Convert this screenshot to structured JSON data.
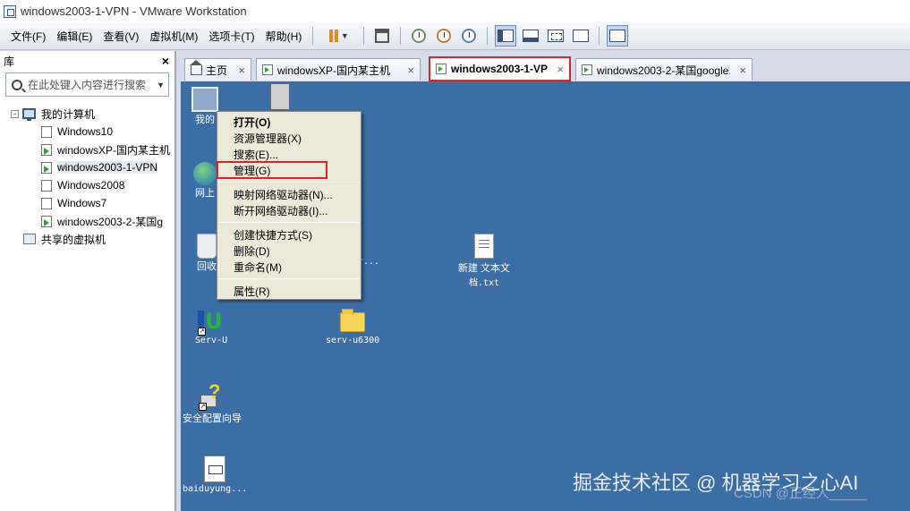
{
  "window": {
    "title": "windows2003-1-VPN - VMware Workstation"
  },
  "menubar": {
    "items": [
      "文件(F)",
      "编辑(E)",
      "查看(V)",
      "虚拟机(M)",
      "选项卡(T)",
      "帮助(H)"
    ]
  },
  "library": {
    "title": "库",
    "close": "×",
    "search_placeholder": "在此处键入内容进行搜索",
    "root": "我的计算机",
    "vms": [
      "Windows10",
      "windowsXP-国内某主机",
      "windows2003-1-VPN",
      "Windows2008",
      "Windows7",
      "windows2003-2-某国g"
    ],
    "shared": "共享的虚拟机"
  },
  "tabs": [
    {
      "label": "主页"
    },
    {
      "label": "windowsXP-国内某主机"
    },
    {
      "label": "windows2003-1-VPN"
    },
    {
      "label": "windows2003-2-某国google..."
    }
  ],
  "tab_close": "×",
  "desktop": {
    "icons": {
      "my_computer": "我的",
      "network": "网上",
      "recycle": "回收",
      "partial": "r...",
      "new_txt_line1": "新建 文本文",
      "new_txt_line2": "档.txt",
      "servu": "Serv-U",
      "servu_folder": "serv-u6300",
      "wizard": "安全配置向导",
      "baidu": "baiduyung..."
    }
  },
  "context_menu": {
    "items": {
      "open": "打开(O)",
      "explorer": "资源管理器(X)",
      "search": "搜索(E)...",
      "manage": "管理(G)",
      "map_drive": "映射网络驱动器(N)...",
      "disconnect_drive": "断开网络驱动器(I)...",
      "create_shortcut": "创建快捷方式(S)",
      "delete": "删除(D)",
      "rename": "重命名(M)",
      "properties": "属性(R)"
    }
  },
  "watermark": {
    "main": "掘金技术社区 @ 机器学习之心AI",
    "faint": "CSDN @正经人_____"
  },
  "colors": {
    "desktop_bg": "#3a6ea5",
    "highlight_box": "#d9262b",
    "pause_accent": "#e58a1f"
  }
}
